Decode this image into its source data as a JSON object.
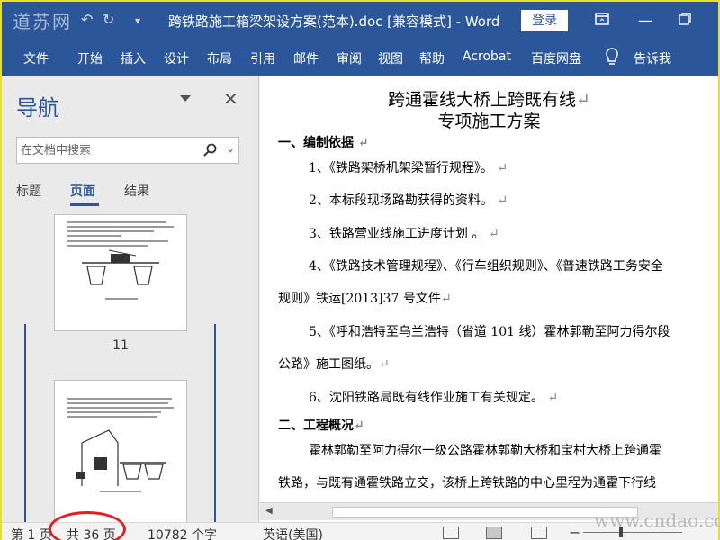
{
  "titlebar": {
    "watermark": "道苏网",
    "doc_title": "跨铁路施工箱梁架设方案(范本).doc [兼容模式]  -  Word",
    "login_label": "登录"
  },
  "ribbon": {
    "tabs": [
      "文件",
      "开始",
      "插入",
      "设计",
      "布局",
      "引用",
      "邮件",
      "审阅",
      "视图",
      "帮助",
      "Acrobat",
      "百度网盘",
      "告诉我"
    ]
  },
  "nav": {
    "title": "导航",
    "search_placeholder": "在文档中搜索",
    "tabs": [
      "标题",
      "页面",
      "结果"
    ],
    "active_tab": "页面",
    "page_numbers": [
      "11",
      ""
    ]
  },
  "document": {
    "title_line1": "跨通霍线大桥上跨既有线",
    "title_line2": "专项施工方案",
    "lines": [
      {
        "text": "一、编制依据",
        "bold": true,
        "mark": "↵"
      },
      {
        "text": "1、《铁路架桥机架梁暂行规程》。",
        "bold": false,
        "mark": "↵"
      },
      {
        "text": "2、本标段现场路勘获得的资料。",
        "bold": false,
        "mark": "↵"
      },
      {
        "text": "3、铁路营业线施工进度计划  。",
        "bold": false,
        "mark": "↵"
      },
      {
        "text": "4、《铁路技术管理规程》、《行车组织规则》、《普速铁路工务安全",
        "bold": false,
        "mark": ""
      },
      {
        "text": "规则》铁运[2013]37 号文件",
        "bold": false,
        "mark": "↵"
      },
      {
        "text": "5、《呼和浩特至乌兰浩特（省道 101 线）霍林郭勒至阿力得尔段",
        "bold": false,
        "mark": ""
      },
      {
        "text": "公路》施工图纸。",
        "bold": false,
        "mark": "↵"
      },
      {
        "text": "6、沈阳铁路局既有线作业施工有关规定。",
        "bold": false,
        "mark": "↵"
      },
      {
        "text": "二、工程概况",
        "bold": true,
        "mark": "↵"
      },
      {
        "text": "霍林郭勒至阿力得尔一级公路霍林郭勒大桥和宝村大桥上跨通霍",
        "bold": false,
        "mark": ""
      },
      {
        "text": "铁路，与既有通霍铁路立交，该桥上跨铁路的中心里程为通霍下行线",
        "bold": false,
        "mark": ""
      }
    ]
  },
  "status": {
    "page": "第 1 页",
    "total": "共 36 页",
    "words": "10782 个字",
    "lang": "英语(美国)",
    "watermark": "www.cndao.com"
  },
  "colors": {
    "accent": "#2b579a",
    "highlight_circle": "#e02020"
  }
}
